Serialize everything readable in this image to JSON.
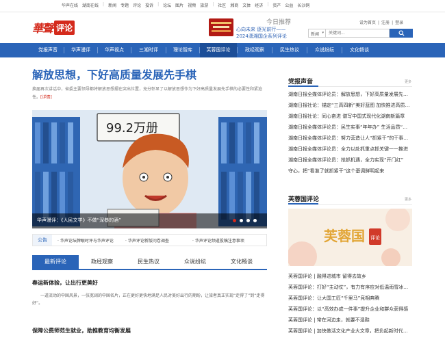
{
  "topbar": {
    "links": [
      "华声在线",
      "湖南在线",
      "|",
      "新闻",
      "专题",
      "评论",
      "投诉",
      "|",
      "论坛",
      "图片",
      "视频",
      "旅游",
      "|",
      "社区",
      "湘商",
      "文体",
      "经济",
      "|",
      "资产",
      "公益",
      "长沙网"
    ]
  },
  "header": {
    "logo_script": "華聲",
    "logo_box": "评论",
    "promo_title": "今日推荐",
    "promo_line1": "心向未来 逐光前行——",
    "promo_line2": "2024潇湘国企系列评论",
    "toplinks": [
      "设为首页",
      "|",
      "注册",
      "|",
      "登录"
    ],
    "search_select": "新闻",
    "search_placeholder": "关键词...",
    "colors": {
      "brand_red": "#d42a1c",
      "brand_blue": "#2a64b8"
    }
  },
  "nav": {
    "items": [
      "党报声音",
      "华声漫评",
      "华声视点",
      "三湘时评",
      "理论智库",
      "芙蓉国评论",
      "政经观察",
      "民生热议",
      "众说纷纭",
      "文化畅谈"
    ],
    "active_index": 5
  },
  "main": {
    "headline": "解放思想，下好高质量发展先手棋",
    "lead": "换届再次讲话中，省委主要领导都将解放思想摆在突出位置，充分彰显了以解放思想作为下好高质量发展先手棋的必要性和紧迫性。",
    "lead_more": "[详情]",
    "hero_caption": "华声漫评：《人民文学》不做“深巷的酒”",
    "hero_sign": "99.2万册",
    "notice_tag": "公告",
    "notices": [
      "· 华声论坛牌眼时评与华声评论",
      "· 华声评论新版问卷调查",
      "· 华声评论频道投稿注意事项"
    ],
    "tabs": [
      "最新评论",
      "政经观察",
      "民生热议",
      "众说纷纭",
      "文化畅谈"
    ],
    "active_tab": 0,
    "articles": [
      {
        "title": "春运新体验，让出行更美好",
        "body": "一道流动的中国风景，一张宽阔的中国名片，正在更好更快地满足人民对美好出行的期盼，让旅者真正实现“走得了”到“走得好”。"
      },
      {
        "title": "保障公费师范生就业，助推教育均衡发展",
        "body": ""
      }
    ]
  },
  "right": {
    "section1_title": "党报声音",
    "more": "更多",
    "section1_items": [
      "湖南日报全媒体评论员：解放思想，下好高质量发展先手棋",
      "湖南日报社论：锚定“三高四新”美好蓝图 加快推进高质量发展",
      "湖南日报社论：同心奋进 谱写中国式现代化湖南新篇章",
      "湖南日报全媒体评论员：民生实事“年年办” 生活品质“节节高”",
      "湖南日报全媒体评论员：努力营造让人“抓紧干”的干事创业环境",
      "湖南日报全媒体评论员：全力以赴抓重点抓关键一一推进",
      "湖南日报全媒体评论员：抢抓机遇，全力实现“开门红”",
      "守心，把“看准了就抓紧干”这个基调鲜明起来"
    ],
    "section2_title": "芙蓉国评论",
    "furong_banner_text": "芙蓉国",
    "furong_banner_box": "评论",
    "section2_items": [
      "芙蓉国评论 | 融得进城市 留得去故乡",
      "芙蓉国评论：打好“主动仗”，有力有序应对低温雨雪冰冻天气",
      "芙蓉国评论：让大国工匠“千里马”竞相奔腾",
      "芙蓉国评论：以“高效办成一件事”提升企业和群众获得感",
      "芙蓉国评论 | 常在河边走，就要不湿鞋",
      "芙蓉国评论 | 加快做活文化产业大文章，把负起新时代文化使命"
    ]
  }
}
